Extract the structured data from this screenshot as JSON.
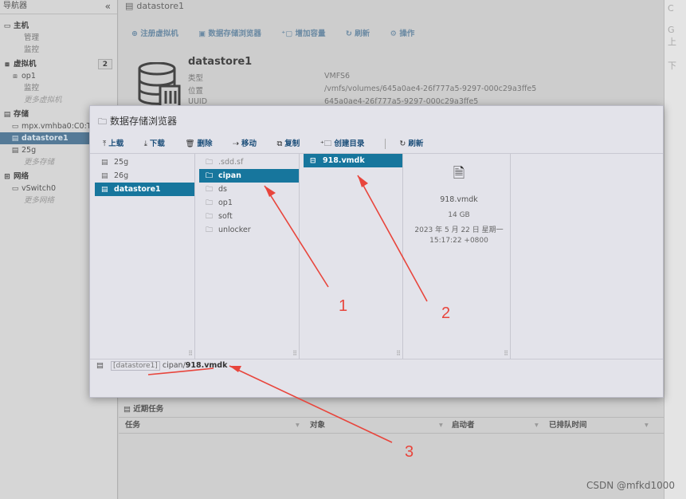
{
  "navigator": {
    "title": "导航器",
    "collapse_icon": "«",
    "items": [
      {
        "label": "主机",
        "kind": "section",
        "icon": "host-icon"
      },
      {
        "label": "管理",
        "kind": "sub"
      },
      {
        "label": "监控",
        "kind": "sub"
      },
      {
        "label": "虚拟机",
        "kind": "section",
        "icon": "vm-icon",
        "badge": "2"
      },
      {
        "label": "op1",
        "kind": "item",
        "icon": "vm-icon"
      },
      {
        "label": "监控",
        "kind": "sub"
      },
      {
        "label": "更多虚拟机",
        "kind": "italic"
      },
      {
        "label": "存储",
        "kind": "section",
        "icon": "storage-icon"
      },
      {
        "label": "mpx.vmhba0:C0:T",
        "kind": "item",
        "icon": "disk-icon"
      },
      {
        "label": "datastore1",
        "kind": "selected",
        "icon": "datastore-icon"
      },
      {
        "label": "25g",
        "kind": "item",
        "icon": "datastore-icon"
      },
      {
        "label": "更多存储",
        "kind": "italic"
      },
      {
        "label": "网络",
        "kind": "section",
        "icon": "network-icon"
      },
      {
        "label": "vSwitch0",
        "kind": "item",
        "icon": "switch-icon"
      },
      {
        "label": "更多网络",
        "kind": "italic"
      }
    ]
  },
  "main": {
    "title": "datastore1",
    "toolbar": [
      "注册虚拟机",
      "数据存储浏览器",
      "增加容量",
      "刷新",
      "操作"
    ],
    "datastore": {
      "name": "datastore1",
      "props": [
        {
          "label": "类型",
          "value": "VMFS6"
        },
        {
          "label": "位置",
          "value": "/vmfs/volumes/645a0ae4-26f777a5-9297-000c29a3ffe5"
        },
        {
          "label": "UUID",
          "value": "645a0ae4-26f777a5-9297-000c29a3ffe5"
        }
      ]
    }
  },
  "tasks": {
    "title": "近期任务",
    "columns": [
      "任务",
      "对象",
      "启动者",
      "已排队时间"
    ]
  },
  "dialog": {
    "title": "数据存储浏览器",
    "toolbar": {
      "upload": "上载",
      "download": "下载",
      "delete": "删除",
      "move": "移动",
      "copy": "复制",
      "mkdir": "创建目录",
      "refresh": "刷新"
    },
    "datastores": [
      {
        "label": "25g",
        "selected": false
      },
      {
        "label": "26g",
        "selected": false
      },
      {
        "label": "datastore1",
        "selected": true
      }
    ],
    "folders": [
      {
        "label": ".sdd.sf",
        "selected": false
      },
      {
        "label": "cipan",
        "selected": true
      },
      {
        "label": "ds",
        "selected": false
      },
      {
        "label": "op1",
        "selected": false
      },
      {
        "label": "soft",
        "selected": false
      },
      {
        "label": "unlocker",
        "selected": false
      }
    ],
    "files": [
      {
        "label": "918.vmdk",
        "selected": true
      }
    ],
    "preview": {
      "name": "918.vmdk",
      "size": "14 GB",
      "modified": "2023 年 5 月 22 日 星期一 15:17:22 +0800"
    },
    "path": {
      "datastore": "[datastore1]",
      "folder": "cipan/",
      "file": "918.vmdk"
    }
  },
  "right_panel": {
    "items": [
      "C",
      "G 上",
      "下"
    ]
  },
  "annotations": {
    "color": "#e8453c",
    "labels": [
      "1",
      "2",
      "3"
    ]
  },
  "watermark": "CSDN @mfkd1000"
}
